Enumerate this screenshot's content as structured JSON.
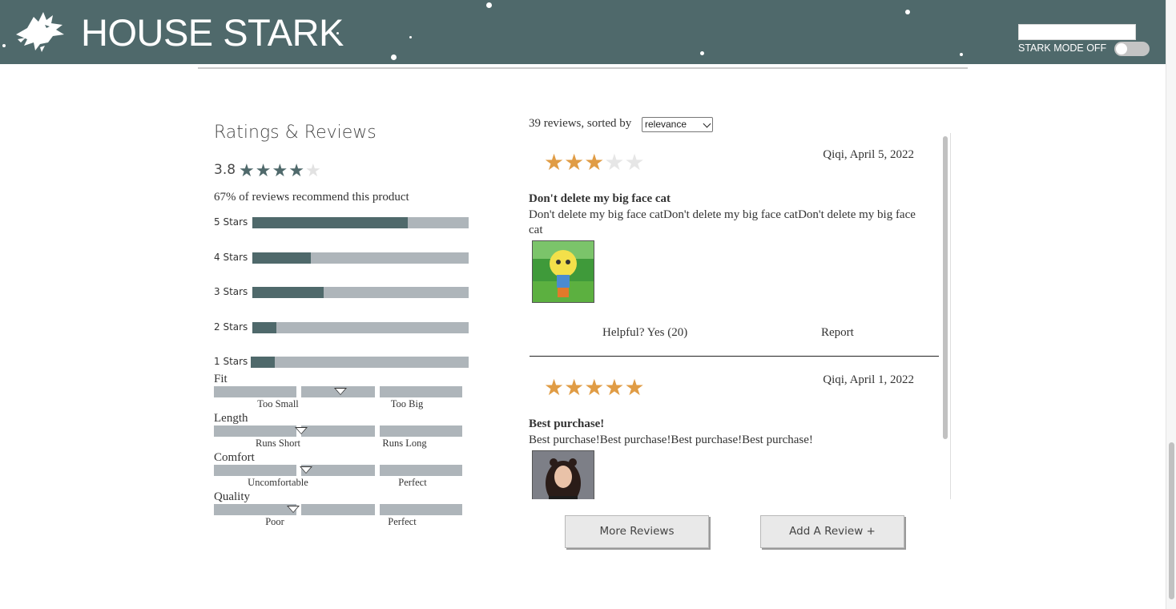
{
  "header": {
    "brand": "HOUSE STARK",
    "search_value": "",
    "mode_label": "STARK MODE OFF",
    "toggle_on": false,
    "bg_color": "#4f696b"
  },
  "ratings": {
    "title": "Ratings & Reviews",
    "average": "3.8",
    "average_stars_filled": 4,
    "recommend_text": "67% of reviews recommend this product",
    "breakdown": [
      {
        "label": "5 Stars",
        "fraction": 0.72
      },
      {
        "label": "4 Stars",
        "fraction": 0.27
      },
      {
        "label": "3 Stars",
        "fraction": 0.33
      },
      {
        "label": "2 Stars",
        "fraction": 0.11
      },
      {
        "label": "1 Stars",
        "fraction": 0.11
      }
    ],
    "characteristics": [
      {
        "name": "Fit",
        "low": "Too Small",
        "high": "Too Big",
        "value": 0.51
      },
      {
        "name": "Length",
        "low": "Runs Short",
        "high": "Runs Long",
        "value": 0.35
      },
      {
        "name": "Comfort",
        "low": "Uncomfortable",
        "high": "Perfect",
        "value": 0.37
      },
      {
        "name": "Quality",
        "low": "Poor",
        "high": "Perfect",
        "value": 0.32
      }
    ]
  },
  "reviews": {
    "count_text": "39 reviews, sorted by",
    "sort_value": "relevance",
    "list": [
      {
        "rating": 3,
        "meta": "Qiqi, April 5, 2022",
        "summary": "Don't delete my big face cat",
        "body": "Don't delete my big face catDon't delete my big face catDon't delete my big face cat",
        "helpful": "Helpful? Yes (20)",
        "report": "Report"
      },
      {
        "rating": 5,
        "meta": "Qiqi, April 1, 2022",
        "summary": "Best purchase!",
        "body": "Best purchase!Best purchase!Best purchase!Best purchase!",
        "helpful": "",
        "report": ""
      }
    ],
    "more_button": "More Reviews",
    "add_button": "Add A Review +"
  }
}
